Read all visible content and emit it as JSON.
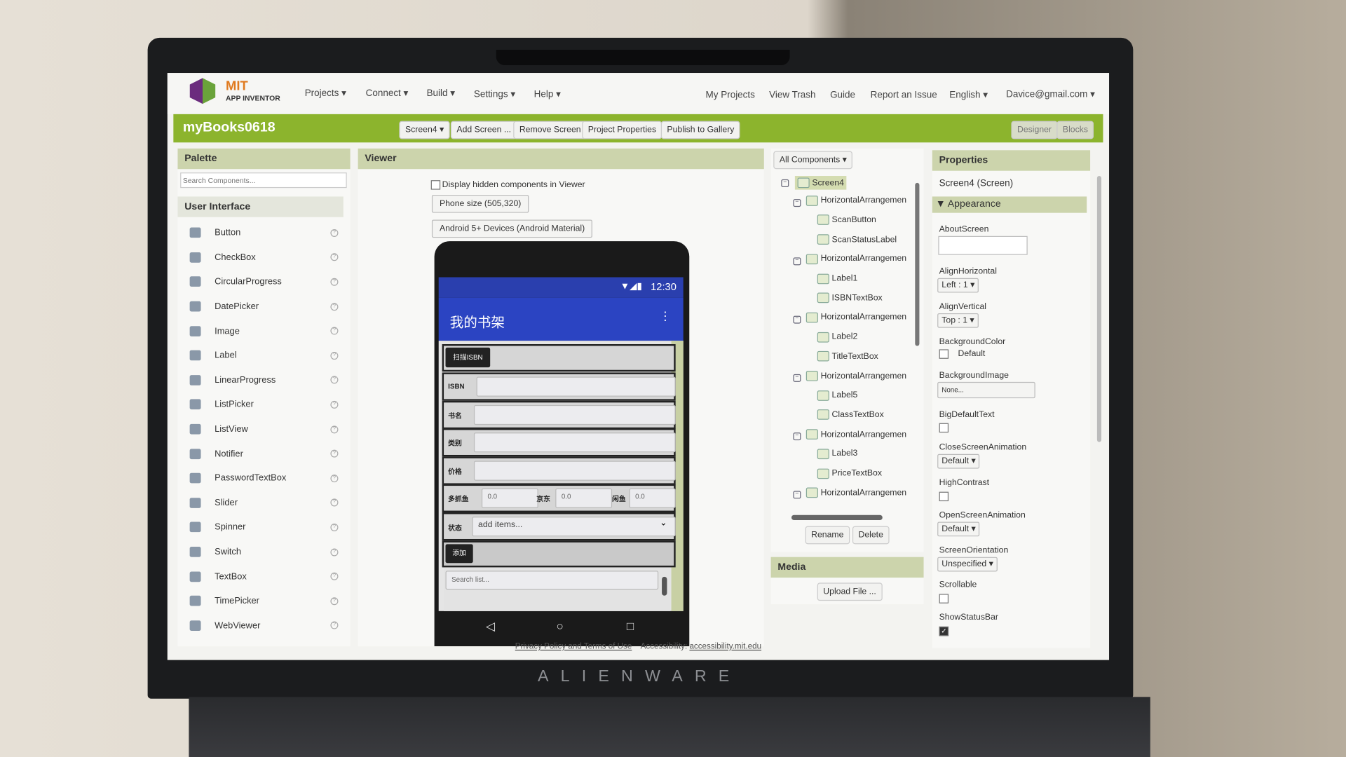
{
  "brand": "ALIENWARE",
  "app": {
    "logo_top": "MIT",
    "logo_bottom": "APP INVENTOR",
    "menus": [
      "Projects ▾",
      "Connect ▾",
      "Build ▾",
      "Settings ▾",
      "Help ▾"
    ],
    "right_links": [
      "My Projects",
      "View Trash",
      "Guide",
      "Report an Issue",
      "English ▾",
      "Davice@gmail.com ▾"
    ]
  },
  "toolbar": {
    "project": "myBooks0618",
    "screen": "Screen4 ▾",
    "add_screen": "Add Screen ...",
    "remove_screen": "Remove Screen",
    "project_properties": "Project Properties",
    "publish": "Publish to Gallery",
    "designer": "Designer",
    "blocks": "Blocks"
  },
  "palette": {
    "title": "Palette",
    "search_placeholder": "Search Components...",
    "category": "User Interface",
    "items": [
      "Button",
      "CheckBox",
      "CircularProgress",
      "DatePicker",
      "Image",
      "Label",
      "LinearProgress",
      "ListPicker",
      "ListView",
      "Notifier",
      "PasswordTextBox",
      "Slider",
      "Spinner",
      "Switch",
      "TextBox",
      "TimePicker",
      "WebViewer"
    ]
  },
  "viewer": {
    "title": "Viewer",
    "hidden_label": "Display hidden components in Viewer",
    "size_select": "Phone size (505,320)",
    "theme_select": "Android 5+ Devices (Android Material)",
    "phone": {
      "time": "12:30",
      "app_title": "我的书架",
      "scan_button": "扫描ISBN",
      "isbn_label": "ISBN",
      "title_label": "书名",
      "class_label": "类别",
      "price_label": "价格",
      "store1": "多抓鱼",
      "store2": "京东",
      "store3": "闲鱼",
      "price1": "0.0",
      "price2": "0.0",
      "price3": "0.0",
      "status_label": "状态",
      "spinner": "add items...",
      "add_button": "添加",
      "search_placeholder": "Search list..."
    }
  },
  "components": {
    "filter": "All Components ▾",
    "tree": [
      {
        "label": "Screen4",
        "level": 0
      },
      {
        "label": "HorizontalArrangemen",
        "level": 1
      },
      {
        "label": "ScanButton",
        "level": 2
      },
      {
        "label": "ScanStatusLabel",
        "level": 2
      },
      {
        "label": "HorizontalArrangemen",
        "level": 1
      },
      {
        "label": "Label1",
        "level": 2
      },
      {
        "label": "ISBNTextBox",
        "level": 2
      },
      {
        "label": "HorizontalArrangemen",
        "level": 1
      },
      {
        "label": "Label2",
        "level": 2
      },
      {
        "label": "TitleTextBox",
        "level": 2
      },
      {
        "label": "HorizontalArrangemen",
        "level": 1
      },
      {
        "label": "Label5",
        "level": 2
      },
      {
        "label": "ClassTextBox",
        "level": 2
      },
      {
        "label": "HorizontalArrangemen",
        "level": 1
      },
      {
        "label": "Label3",
        "level": 2
      },
      {
        "label": "PriceTextBox",
        "level": 2
      },
      {
        "label": "HorizontalArrangemen",
        "level": 1
      }
    ],
    "rename": "Rename",
    "delete": "Delete"
  },
  "media": {
    "title": "Media",
    "upload": "Upload File ..."
  },
  "properties": {
    "title": "Properties",
    "component": "Screen4 (Screen)",
    "section": "▼ Appearance",
    "about": "AboutScreen",
    "align_h": "AlignHorizontal",
    "align_h_val": "Left : 1 ▾",
    "align_v": "AlignVertical",
    "align_v_val": "Top : 1 ▾",
    "bg_color": "BackgroundColor",
    "bg_color_val": "Default",
    "bg_image": "BackgroundImage",
    "bg_image_val": "None...",
    "big_text": "BigDefaultText",
    "close_anim": "CloseScreenAnimation",
    "close_anim_val": "Default ▾",
    "high_contrast": "HighContrast",
    "open_anim": "OpenScreenAnimation",
    "open_anim_val": "Default ▾",
    "orientation": "ScreenOrientation",
    "orientation_val": "Unspecified ▾",
    "scrollable": "Scrollable",
    "status_bar": "ShowStatusBar",
    "status_bar_checked": true
  },
  "footer": {
    "privacy": "Privacy Policy and Terms of Use",
    "accessibility_label": "Accessibility:",
    "accessibility_link": "accessibility.mit.edu"
  }
}
